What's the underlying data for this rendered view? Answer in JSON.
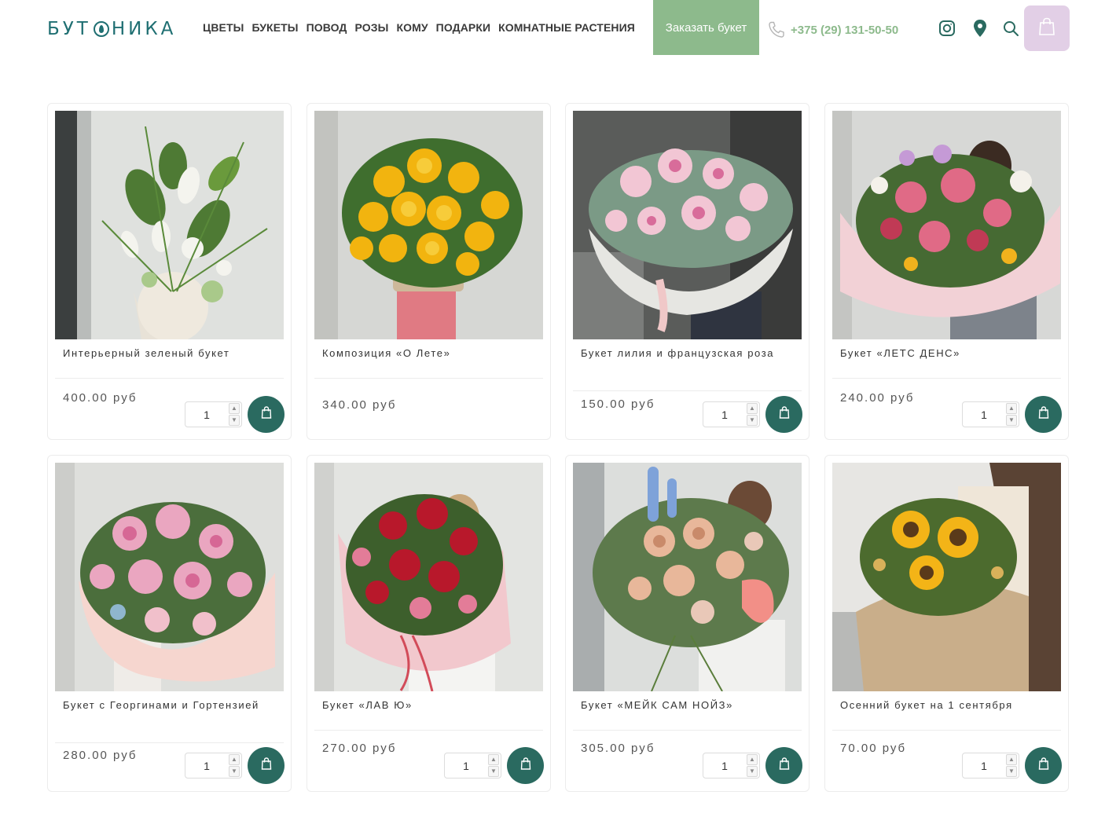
{
  "brand": {
    "name_pre": "БУТ",
    "name_post": "НИКА"
  },
  "nav": [
    "ЦВЕТЫ",
    "БУКЕТЫ",
    "ПОВОД",
    "РОЗЫ",
    "КОМУ",
    "ПОДАРКИ",
    "КОМНАТНЫЕ РАСТЕНИЯ"
  ],
  "order_button": "Заказать букет",
  "phone": "+375 (29) 131-50-50",
  "icons": [
    "phone-icon",
    "instagram-icon",
    "map-pin-icon",
    "search-icon",
    "shopping-bag-icon",
    "cart-icon"
  ],
  "colors": {
    "brand": "#1f6f72",
    "accent_green": "#8dba8c",
    "cart_bg": "#e2cfe6",
    "buy_button": "#2a6a60"
  },
  "products": [
    {
      "title": "Интерьерный зеленый букет",
      "price": "400.00 руб",
      "qty": "1"
    },
    {
      "title": "Композиция «О Лете»",
      "price": "340.00 руб",
      "qty": ""
    },
    {
      "title": "Букет лилия и французская роза",
      "price": "150.00 руб",
      "qty": "1"
    },
    {
      "title": "Букет «ЛЕТС ДЕНС»",
      "price": "240.00 руб",
      "qty": "1"
    },
    {
      "title": "Букет с Георгинами и Гортензией",
      "price": "280.00 руб",
      "qty": "1"
    },
    {
      "title": "Букет «ЛАВ Ю»",
      "price": "270.00 руб",
      "qty": "1"
    },
    {
      "title": "Букет «МЕЙК САМ НОЙЗ»",
      "price": "305.00 руб",
      "qty": "1"
    },
    {
      "title": "Осенний букет на 1 сентября",
      "price": "70.00 руб",
      "qty": "1"
    }
  ]
}
